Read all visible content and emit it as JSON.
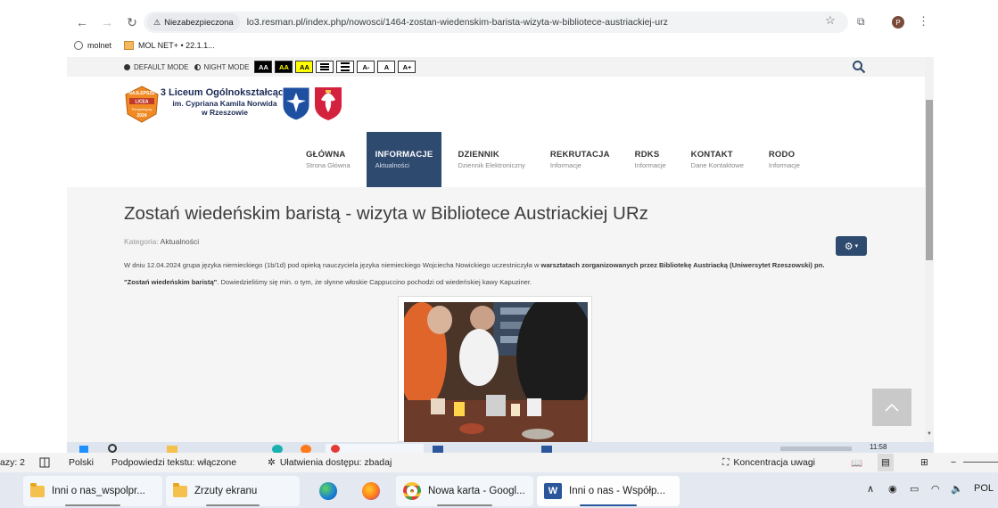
{
  "browser": {
    "security_label": "Niezabezpieczona",
    "url": "lo3.resman.pl/index.php/nowosci/1464-zostan-wiedenskim-barista-wizyta-w-bibliotece-austriackiej-urz",
    "profile_initial": "P",
    "bookmarks": [
      {
        "label": "molnet"
      },
      {
        "label": "MOL NET+ • 22.1.1..."
      }
    ]
  },
  "a11y": {
    "default_mode": "DEFAULT MODE",
    "night_mode": "NIGHT MODE",
    "contrast_buttons": [
      "AA",
      "AA",
      "AA"
    ],
    "font_buttons": [
      "A-",
      "A",
      "A+"
    ]
  },
  "school": {
    "badge_top": "NAJLEPSZE",
    "badge_mid": "LICEA",
    "badge_bottom": "Perspektywy",
    "badge_year": "2024",
    "name_line1": "3 Liceum Ogólnokształcące",
    "name_line2": "im. Cypriana Kamila Norwida",
    "name_line3": "w Rzeszowie"
  },
  "nav": [
    {
      "title": "GŁÓWNA",
      "subtitle": "Strona Główna",
      "active": false
    },
    {
      "title": "INFORMACJE",
      "subtitle": "Aktualności",
      "active": true
    },
    {
      "title": "DZIENNIK",
      "subtitle": "Dziennik Elektroniczny",
      "active": false
    },
    {
      "title": "REKRUTACJA",
      "subtitle": "Informacje",
      "active": false
    },
    {
      "title": "RDKS",
      "subtitle": "Informacje",
      "active": false
    },
    {
      "title": "KONTAKT",
      "subtitle": "Dane Kontaktowe",
      "active": false
    },
    {
      "title": "RODO",
      "subtitle": "Informacje",
      "active": false
    }
  ],
  "article": {
    "title": "Zostań wiedeńskim baristą - wizyta w Bibliotece Austriackiej URz",
    "category_label": "Kategoria:",
    "category_value": "Aktualności",
    "para_1": "W dniu 12.04.2024 grupa języka niemieckiego (1b/1d) pod opieką nauczyciela języka niemieckiego Wojciecha Nowickiego uczestniczyła w ",
    "para_bold_1": "warsztatach zorganizowanych przez Bibliotekę Austriacką (Uniwersytet Rzeszowski) pn.",
    "para_bold_2": "\"Zostań wiedeńskim baristą\"",
    "para_2": ". Dowiedzieliśmy się min. o tym, że słynne włoskie Cappuccino pochodzi od wiedeńskiej kawy Kapuziner."
  },
  "inner_taskbar": {
    "clock": "11:58"
  },
  "wordbar": {
    "words": "azy: 2",
    "language": "Polski",
    "suggestions": "Podpowiedzi tekstu: włączone",
    "accessibility": "Ułatwienia dostępu: zbadaj",
    "focus": "Koncentracja uwagi"
  },
  "taskbar": {
    "items": [
      {
        "label": "Inni o nas_wspolpr..."
      },
      {
        "label": "Zrzuty ekranu"
      },
      {
        "label": "Nowa karta - Googl..."
      },
      {
        "label": "Inni o nas - Współp..."
      }
    ],
    "lang": "POL"
  },
  "colors": {
    "nav_active": "#2f4a6f",
    "chrome_bg": "#f1f3f4",
    "word_blue": "#2b579a"
  }
}
